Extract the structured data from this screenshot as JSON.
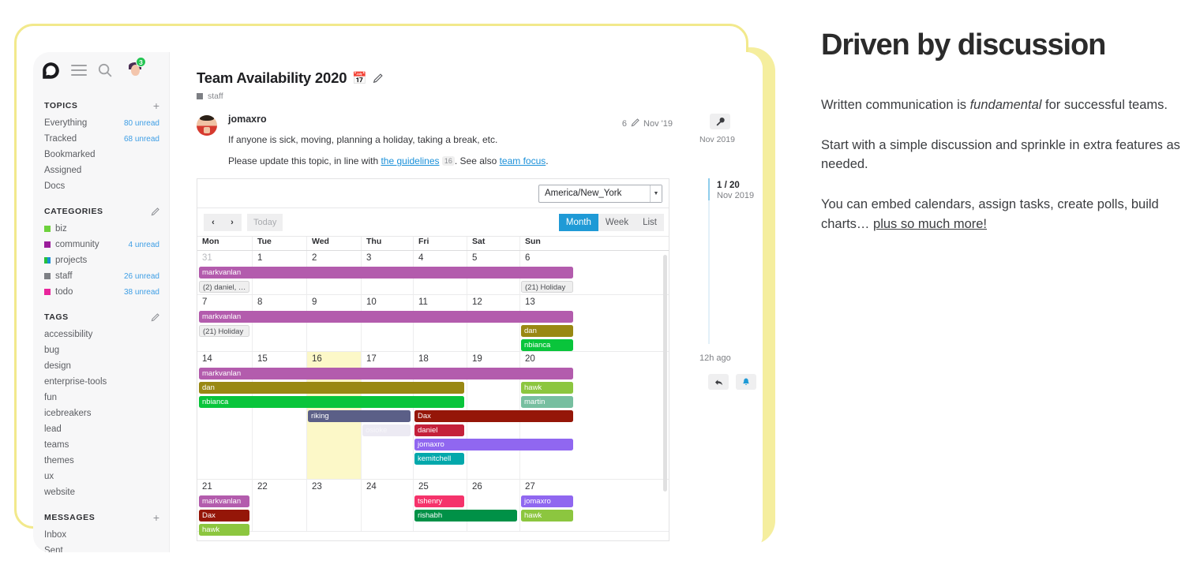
{
  "app": {
    "logo_icon": "discourse-logo-icon",
    "hamburger_icon": "hamburger-menu-icon",
    "search_icon": "search-icon",
    "avatar_icon": "user-avatar",
    "notification_count": "3"
  },
  "sidebar": {
    "sections": [
      {
        "title": "TOPICS",
        "action_icon": "plus-icon",
        "action_label": "+",
        "items": [
          {
            "label": "Everything",
            "unread": "80 unread"
          },
          {
            "label": "Tracked",
            "unread": "68 unread"
          },
          {
            "label": "Bookmarked",
            "unread": ""
          },
          {
            "label": "Assigned",
            "unread": ""
          },
          {
            "label": "Docs",
            "unread": ""
          }
        ]
      },
      {
        "title": "CATEGORIES",
        "action_icon": "pencil-icon",
        "action_label": "",
        "items": [
          {
            "label": "biz",
            "unread": "",
            "color": "#6dd13c"
          },
          {
            "label": "community",
            "unread": "4 unread",
            "color": "#9b1d9b"
          },
          {
            "label": "projects",
            "unread": "",
            "color": "#25c03c",
            "color2": "#1a8fd6"
          },
          {
            "label": "staff",
            "unread": "26 unread",
            "color": "#7d7f84"
          },
          {
            "label": "todo",
            "unread": "38 unread",
            "color": "#e9259c"
          }
        ]
      },
      {
        "title": "TAGS",
        "action_icon": "pencil-icon",
        "action_label": "",
        "items": [
          {
            "label": "accessibility",
            "unread": ""
          },
          {
            "label": "bug",
            "unread": ""
          },
          {
            "label": "design",
            "unread": ""
          },
          {
            "label": "enterprise-tools",
            "unread": ""
          },
          {
            "label": "fun",
            "unread": ""
          },
          {
            "label": "icebreakers",
            "unread": ""
          },
          {
            "label": "lead",
            "unread": ""
          },
          {
            "label": "teams",
            "unread": ""
          },
          {
            "label": "themes",
            "unread": ""
          },
          {
            "label": "ux",
            "unread": ""
          },
          {
            "label": "website",
            "unread": ""
          }
        ]
      },
      {
        "title": "MESSAGES",
        "action_icon": "plus-icon",
        "action_label": "+",
        "items": [
          {
            "label": "Inbox",
            "unread": ""
          },
          {
            "label": "Sent",
            "unread": ""
          }
        ]
      }
    ]
  },
  "topic": {
    "title": "Team Availability 2020",
    "title_emoji": "calendar-emoji",
    "edit_icon": "pencil-icon",
    "category": "staff",
    "category_color": "#7d7f84",
    "post": {
      "author": "jomaxro",
      "reply_count": "6",
      "edit_icon": "pencil-icon",
      "date": "Nov '19",
      "line1": "If anyone is sick, moving, planning a holiday, taking a break, etc.",
      "line2_pre": "Please update this topic, in line with ",
      "line2_link1": "the guidelines",
      "line2_badge": "16",
      "line2_mid": ". See also ",
      "line2_link2": "team focus",
      "line2_post": "."
    }
  },
  "calendar": {
    "timezone": "America/New_York",
    "timezone_caret": "chevron-down-icon",
    "prev_label": "‹",
    "next_label": "›",
    "today_label": "Today",
    "views": [
      {
        "label": "Month",
        "active": true
      },
      {
        "label": "Week",
        "active": false
      },
      {
        "label": "List",
        "active": false
      }
    ],
    "day_headers": [
      "Mon",
      "Tue",
      "Wed",
      "Thu",
      "Fri",
      "Sat",
      "Sun"
    ],
    "today_column": 2,
    "weeks": [
      {
        "days": [
          {
            "num": "31",
            "muted": true
          },
          {
            "num": "1"
          },
          {
            "num": "2"
          },
          {
            "num": "3"
          },
          {
            "num": "4"
          },
          {
            "num": "5"
          },
          {
            "num": "6"
          }
        ],
        "events": [
          {
            "label": "markvanlan",
            "start": 0,
            "span": 7,
            "row": 0,
            "color": "#b35cad"
          },
          {
            "label": "(2) daniel, …",
            "start": 0,
            "span": 1,
            "row": 1,
            "color": "#efefef",
            "text_color": "#4a4c50",
            "border": "#d6d6d7"
          },
          {
            "label": "(21) Holiday",
            "start": 6,
            "span": 1,
            "row": 1,
            "color": "#efefef",
            "text_color": "#4a4c50",
            "border": "#d6d6d7"
          }
        ]
      },
      {
        "days": [
          {
            "num": "7"
          },
          {
            "num": "8"
          },
          {
            "num": "9"
          },
          {
            "num": "10"
          },
          {
            "num": "11"
          },
          {
            "num": "12"
          },
          {
            "num": "13"
          }
        ],
        "events": [
          {
            "label": "markvanlan",
            "start": 0,
            "span": 7,
            "row": 0,
            "color": "#b35cad"
          },
          {
            "label": "(21) Holiday",
            "start": 0,
            "span": 1,
            "row": 1,
            "color": "#efefef",
            "text_color": "#4a4c50",
            "border": "#d6d6d7"
          },
          {
            "label": "dan",
            "start": 6,
            "span": 1,
            "row": 1,
            "color": "#998813"
          },
          {
            "label": "nbianca",
            "start": 6,
            "span": 1,
            "row": 2,
            "color": "#09c53b"
          }
        ]
      },
      {
        "days": [
          {
            "num": "14"
          },
          {
            "num": "15"
          },
          {
            "num": "16",
            "today": true
          },
          {
            "num": "17"
          },
          {
            "num": "18"
          },
          {
            "num": "19"
          },
          {
            "num": "20"
          }
        ],
        "events": [
          {
            "label": "markvanlan",
            "start": 0,
            "span": 7,
            "row": 0,
            "color": "#b35cad"
          },
          {
            "label": "dan",
            "start": 0,
            "span": 5,
            "row": 1,
            "color": "#998813"
          },
          {
            "label": "hawk",
            "start": 6,
            "span": 1,
            "row": 1,
            "color": "#8cc63f"
          },
          {
            "label": "nbianca",
            "start": 0,
            "span": 5,
            "row": 2,
            "color": "#09c53b"
          },
          {
            "label": "martin",
            "start": 6,
            "span": 1,
            "row": 2,
            "color": "#77bfa0"
          },
          {
            "label": "riking",
            "start": 2,
            "span": 2,
            "row": 3,
            "color": "#5b5f87"
          },
          {
            "label": "Dax",
            "start": 4,
            "span": 3,
            "row": 3,
            "color": "#951608"
          },
          {
            "label": "osioke",
            "start": 3,
            "span": 1,
            "row": 4,
            "color": "#eceaf3",
            "faded": true
          },
          {
            "label": "daniel",
            "start": 4,
            "span": 1,
            "row": 4,
            "color": "#c4203a"
          },
          {
            "label": "jomaxro",
            "start": 4,
            "span": 3,
            "row": 5,
            "color": "#9067f0"
          },
          {
            "label": "kemitchell",
            "start": 4,
            "span": 1,
            "row": 6,
            "color": "#03a8ab"
          }
        ]
      },
      {
        "days": [
          {
            "num": "21"
          },
          {
            "num": "22"
          },
          {
            "num": "23"
          },
          {
            "num": "24"
          },
          {
            "num": "25"
          },
          {
            "num": "26"
          },
          {
            "num": "27"
          }
        ],
        "events": [
          {
            "label": "markvanlan",
            "start": 0,
            "span": 1,
            "row": 0,
            "color": "#b35cad"
          },
          {
            "label": "tshenry",
            "start": 4,
            "span": 1,
            "row": 0,
            "color": "#f5336b"
          },
          {
            "label": "jomaxro",
            "start": 6,
            "span": 1,
            "row": 0,
            "color": "#9067f0"
          },
          {
            "label": "Dax",
            "start": 0,
            "span": 1,
            "row": 1,
            "color": "#951608"
          },
          {
            "label": "rishabh",
            "start": 4,
            "span": 2,
            "row": 1,
            "color": "#009147"
          },
          {
            "label": "hawk",
            "start": 6,
            "span": 1,
            "row": 1,
            "color": "#8cc63f"
          },
          {
            "label": "hawk",
            "start": 0,
            "span": 1,
            "row": 2,
            "color": "#8cc63f"
          }
        ]
      }
    ]
  },
  "rail": {
    "wrench_icon": "wrench-icon",
    "top_date": "Nov 2019",
    "current_position": "1 / 20",
    "current_date": "Nov 2019",
    "last_activity": "12h ago",
    "reply_icon": "reply-arrow-icon",
    "notify_icon": "bell-icon"
  },
  "copy": {
    "heading": "Driven by discussion",
    "p1_pre": "Written communication is ",
    "p1_em": "fundamental",
    "p1_post": " for successful teams.",
    "p2": "Start with a simple discussion and sprinkle in extra features as needed.",
    "p3_pre": "You can embed calendars, assign tasks, create polls, build charts… ",
    "p3_link": "plus so much more!"
  }
}
